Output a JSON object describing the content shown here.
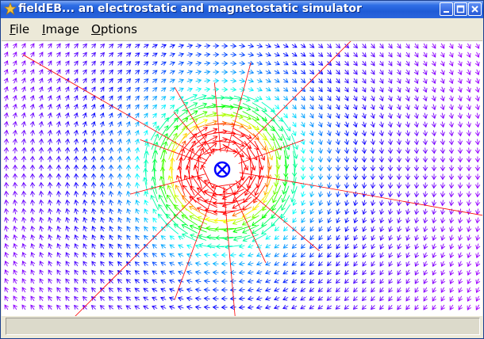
{
  "window": {
    "title": "fieldEB... an electrostatic and magnetostatic simulator"
  },
  "menu": {
    "file": {
      "accel": "F",
      "rest": "ile"
    },
    "image": {
      "accel": "I",
      "rest": "mage"
    },
    "options": {
      "accel": "O",
      "rest": "ptions"
    }
  },
  "field": {
    "source_symbol": "⊗",
    "source_color": "#0000ff",
    "color_scale": [
      "#ff00ff",
      "#0000ff",
      "#00ffff",
      "#00ff00",
      "#ffff00",
      "#ff0000"
    ],
    "field_line_color": "#ff0000"
  },
  "status": {
    "text": ""
  }
}
